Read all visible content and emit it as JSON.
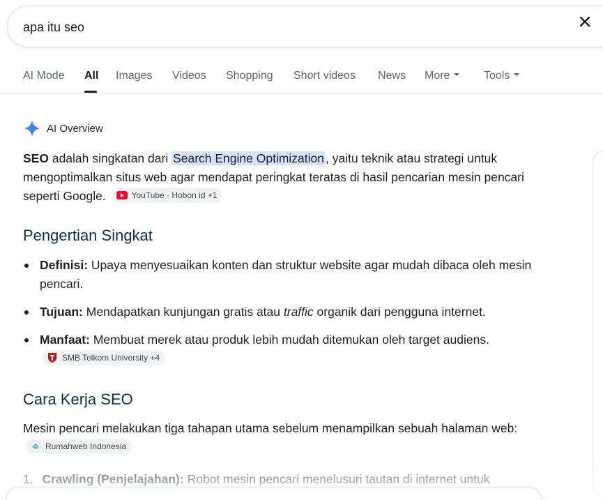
{
  "search": {
    "query": "apa itu seo",
    "clear_icon": "close-icon"
  },
  "tabs": [
    {
      "label": "AI Mode"
    },
    {
      "label": "All",
      "active": true
    },
    {
      "label": "Images"
    },
    {
      "label": "Videos"
    },
    {
      "label": "Shopping"
    },
    {
      "label": "Short videos"
    },
    {
      "label": "News"
    },
    {
      "label": "More",
      "dropdown": true
    },
    {
      "label": "Tools",
      "dropdown": true
    }
  ],
  "ai_overview": {
    "label": "AI Overview",
    "icon": "sparkle-icon",
    "accent_color": "#4285f4",
    "intro": {
      "term": "SEO",
      "text_before": " adalah singkatan dari ",
      "highlight": "Search Engine Optimization",
      "text_after": ", yaitu teknik atau strategi untuk mengoptimalkan situs web agar mendapat peringkat teratas di hasil pencarian mesin pencari seperti Google.",
      "source_chip": "YouTube · Hobon id +1"
    },
    "section1": {
      "heading": "Pengertian Singkat",
      "items": [
        {
          "term": "Definisi:",
          "text": " Upaya menyesuaikan konten dan struktur website agar mudah dibaca oleh mesin pencari."
        },
        {
          "term": "Tujuan:",
          "text": " Mendapatkan kunjungan gratis atau ",
          "italic": "traffic",
          "text2": " organik dari pengguna internet."
        },
        {
          "term": "Manfaat:",
          "text": " Membuat merek atau produk lebih mudah ditemukan oleh target audiens.",
          "source_chip": "SMB Telkom University +4"
        }
      ]
    },
    "section2": {
      "heading": "Cara Kerja SEO",
      "text": "Mesin pencari melakukan tiga tahapan utama sebelum menampilkan sebuah halaman web:",
      "source_chip": "Rumahweb Indonesia",
      "list_item": {
        "number": "1.",
        "term": "Crawling (Penjelajahan):",
        "text": " Robot mesin pencari menelusuri tautan di internet untuk"
      }
    }
  }
}
